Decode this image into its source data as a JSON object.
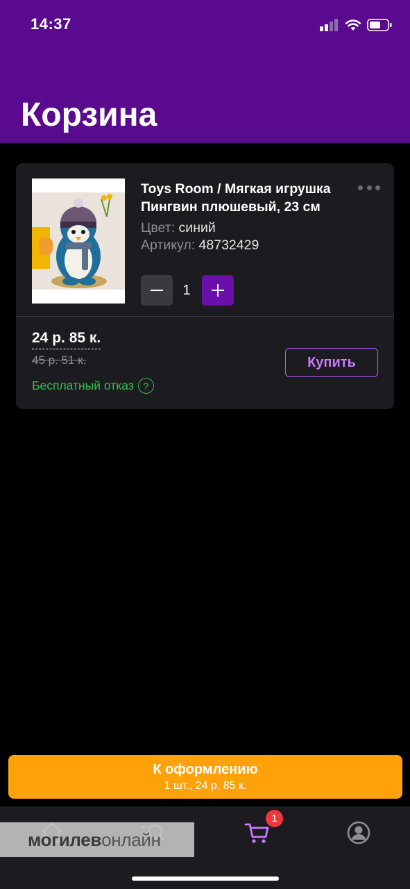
{
  "status_bar": {
    "time": "14:37"
  },
  "header": {
    "title": "Корзина"
  },
  "cart_item": {
    "title": "Toys Room / Мягкая игрушка Пингвин плюшевый, 23 см",
    "color_label": "Цвет:",
    "color_value": "синий",
    "sku_label": "Артикул:",
    "sku_value": "48732429",
    "quantity": "1",
    "price": "24 р. 85 к.",
    "old_price": "45 р. 51 к.",
    "refund_text": "Бесплатный отказ",
    "refund_help": "?",
    "buy_label": "Купить"
  },
  "checkout": {
    "label": "К оформлению",
    "summary": "1 шт., 24 р. 85 к."
  },
  "tabbar": {
    "items": [
      "home-icon",
      "catalog-search-icon",
      "cart-icon",
      "profile-icon"
    ],
    "active": "cart-icon",
    "cart_badge": "1"
  },
  "watermark": {
    "bold": "могилев",
    "light": "онлайн"
  },
  "colors": {
    "header_bg": "#5a0a8f",
    "accent": "#6a0fa8",
    "buy_border": "#b25cf2",
    "checkout": "#ffa20a",
    "refund": "#2ec24e",
    "badge": "#f0373a"
  }
}
